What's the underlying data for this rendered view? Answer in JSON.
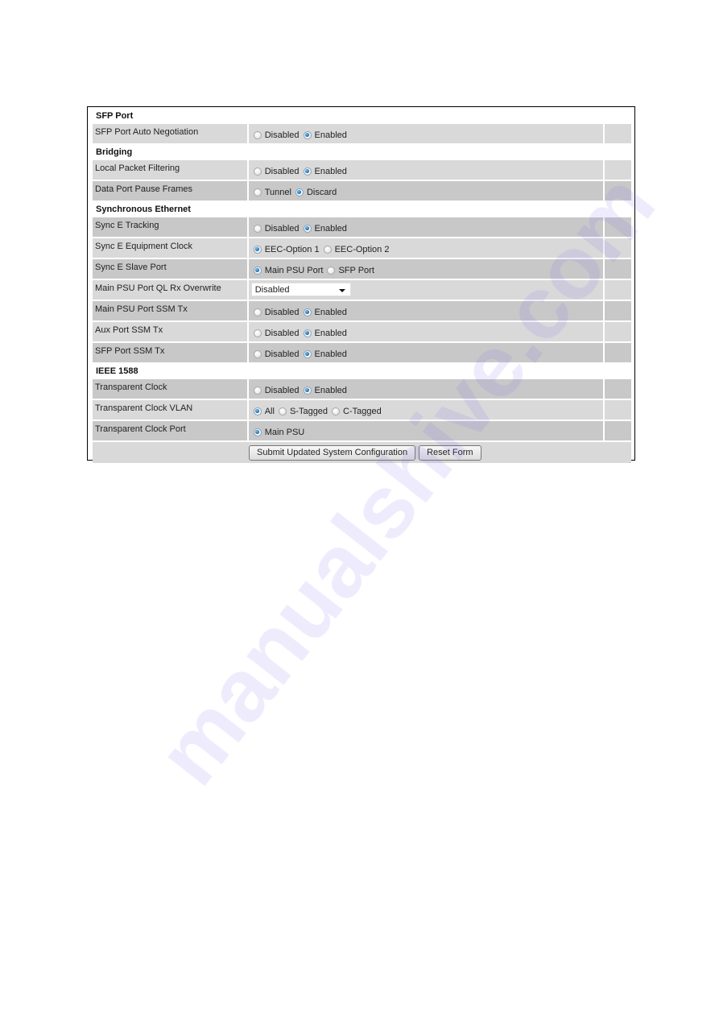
{
  "sections": [
    {
      "title": "SFP Port",
      "rows": [
        {
          "label": "SFP Port Auto Negotiation",
          "shade": "light",
          "type": "radio",
          "options": [
            {
              "label": "Disabled",
              "checked": false
            },
            {
              "label": "Enabled",
              "checked": true
            }
          ]
        }
      ]
    },
    {
      "title": "Bridging",
      "rows": [
        {
          "label": "Local Packet Filtering",
          "shade": "light",
          "type": "radio",
          "options": [
            {
              "label": "Disabled",
              "checked": false
            },
            {
              "label": "Enabled",
              "checked": true
            }
          ]
        },
        {
          "label": "Data Port Pause Frames",
          "shade": "dark",
          "type": "radio",
          "options": [
            {
              "label": "Tunnel",
              "checked": false
            },
            {
              "label": "Discard",
              "checked": true
            }
          ]
        }
      ]
    },
    {
      "title": "Synchronous Ethernet",
      "rows": [
        {
          "label": "Sync E Tracking",
          "shade": "dark",
          "type": "radio",
          "options": [
            {
              "label": "Disabled",
              "checked": false
            },
            {
              "label": "Enabled",
              "checked": true
            }
          ]
        },
        {
          "label": "Sync E Equipment Clock",
          "shade": "light",
          "type": "radio",
          "options": [
            {
              "label": "EEC-Option 1",
              "checked": true
            },
            {
              "label": "EEC-Option 2",
              "checked": false
            }
          ]
        },
        {
          "label": "Sync E Slave Port",
          "shade": "dark",
          "type": "radio",
          "options": [
            {
              "label": "Main PSU Port",
              "checked": true
            },
            {
              "label": "SFP Port",
              "checked": false
            }
          ]
        },
        {
          "label": "Main PSU Port QL Rx Overwrite",
          "shade": "light",
          "type": "select",
          "selected": "Disabled"
        },
        {
          "label": "Main PSU Port SSM Tx",
          "shade": "dark",
          "type": "radio",
          "options": [
            {
              "label": "Disabled",
              "checked": false
            },
            {
              "label": "Enabled",
              "checked": true
            }
          ]
        },
        {
          "label": "Aux Port SSM Tx",
          "shade": "light",
          "type": "radio",
          "options": [
            {
              "label": "Disabled",
              "checked": false
            },
            {
              "label": "Enabled",
              "checked": true
            }
          ]
        },
        {
          "label": "SFP Port SSM Tx",
          "shade": "dark",
          "type": "radio",
          "options": [
            {
              "label": "Disabled",
              "checked": false
            },
            {
              "label": "Enabled",
              "checked": true
            }
          ]
        }
      ]
    },
    {
      "title": "IEEE 1588",
      "rows": [
        {
          "label": "Transparent Clock",
          "shade": "dark",
          "type": "radio",
          "options": [
            {
              "label": "Disabled",
              "checked": false
            },
            {
              "label": "Enabled",
              "checked": true
            }
          ]
        },
        {
          "label": "Transparent Clock VLAN",
          "shade": "light",
          "type": "radio",
          "options": [
            {
              "label": "All",
              "checked": true
            },
            {
              "label": "S-Tagged",
              "checked": false
            },
            {
              "label": "C-Tagged",
              "checked": false
            }
          ]
        },
        {
          "label": "Transparent Clock Port",
          "shade": "dark",
          "type": "radio",
          "options": [
            {
              "label": "Main PSU",
              "checked": true
            }
          ]
        }
      ]
    }
  ],
  "buttons": {
    "submit_label": "Submit Updated System Configuration",
    "reset_label": "Reset Form"
  },
  "watermark": "manualshive.com",
  "colors": {
    "row_light": "#d9d9d9",
    "row_dark": "#c8c8c8",
    "radio_selected": "#1f6fae"
  }
}
